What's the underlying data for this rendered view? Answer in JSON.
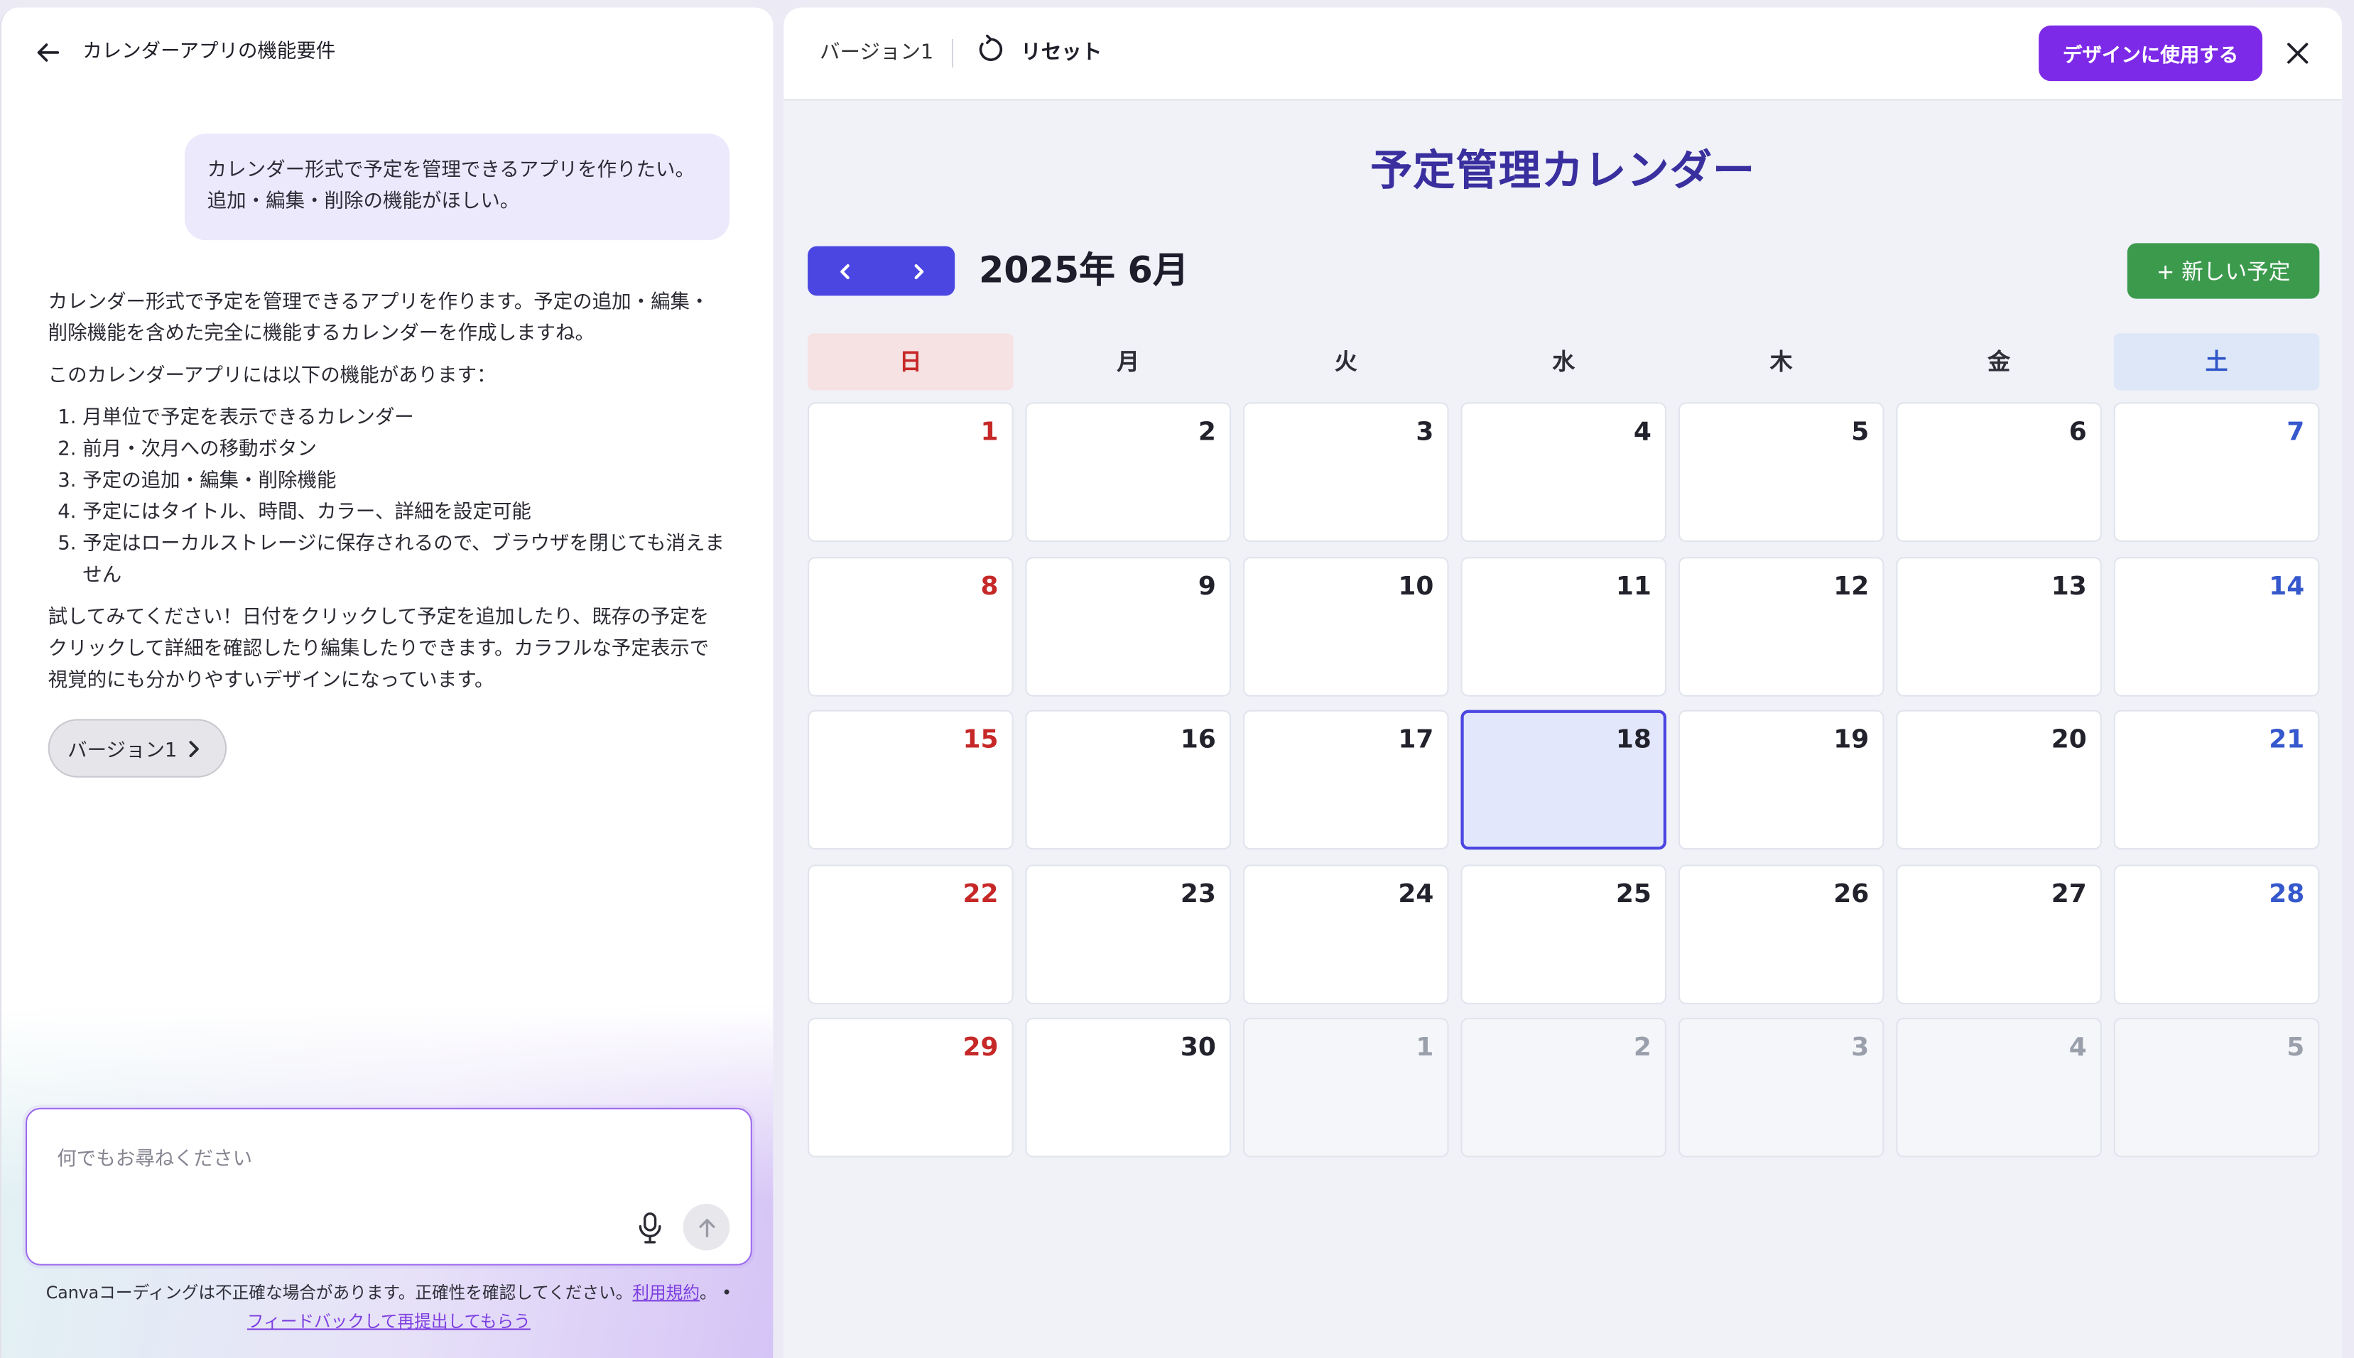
{
  "chat": {
    "header": {
      "back_icon": "arrow-left-icon",
      "title": "カレンダーアプリの機能要件"
    },
    "user_message": [
      "カレンダー形式で予定を管理できるアプリを作りたい。",
      "追加・編集・削除の機能がほしい。"
    ],
    "assistant": {
      "intro": "カレンダー形式で予定を管理できるアプリを作ります。予定の追加・編集・削除機能を含めた完全に機能するカレンダーを作成しますね。",
      "features_intro": "このカレンダーアプリには以下の機能があります：",
      "features": [
        "月単位で予定を表示できるカレンダー",
        "前月・次月への移動ボタン",
        "予定の追加・編集・削除機能",
        "予定にはタイトル、時間、カラー、詳細を設定可能",
        "予定はローカルストレージに保存されるので、ブラウザを閉じても消えません"
      ],
      "closing": "試してみてください！日付をクリックして予定を追加したり、既存の予定をクリックして詳細を確認したり編集したりできます。カラフルな予定表示で視覚的にも分かりやすいデザインになっています。"
    },
    "version_chip": {
      "label": "バージョン1",
      "icon": "chevron-right-icon"
    },
    "composer": {
      "placeholder": "何でもお尋ねください",
      "mic_icon": "microphone-icon",
      "send_icon": "arrow-up-icon"
    },
    "disclaimer": {
      "text": "Canvaコーディングは不正確な場合があります。正確性を確認してください。",
      "terms_link": "利用規約",
      "terms_suffix": "。 •",
      "feedback_link": "フィードバックして再提出してもらう"
    }
  },
  "preview": {
    "header": {
      "version_label": "バージョン1",
      "reset_icon": "refresh-icon",
      "reset_label": "リセット",
      "use_button": "デザインに使用する",
      "close_icon": "close-icon"
    },
    "calendar": {
      "title": "予定管理カレンダー",
      "prev_icon": "chevron-left-icon",
      "next_icon": "chevron-right-icon",
      "month_label": "2025年 6月",
      "new_event_button": "+ 新しい予定",
      "weekdays": [
        "日",
        "月",
        "火",
        "水",
        "木",
        "金",
        "土"
      ],
      "weeks": [
        [
          {
            "day": "1"
          },
          {
            "day": "2"
          },
          {
            "day": "3"
          },
          {
            "day": "4"
          },
          {
            "day": "5"
          },
          {
            "day": "6"
          },
          {
            "day": "7"
          }
        ],
        [
          {
            "day": "8"
          },
          {
            "day": "9"
          },
          {
            "day": "10"
          },
          {
            "day": "11"
          },
          {
            "day": "12"
          },
          {
            "day": "13"
          },
          {
            "day": "14"
          }
        ],
        [
          {
            "day": "15"
          },
          {
            "day": "16"
          },
          {
            "day": "17"
          },
          {
            "day": "18",
            "today": true
          },
          {
            "day": "19"
          },
          {
            "day": "20"
          },
          {
            "day": "21"
          }
        ],
        [
          {
            "day": "22"
          },
          {
            "day": "23"
          },
          {
            "day": "24"
          },
          {
            "day": "25"
          },
          {
            "day": "26"
          },
          {
            "day": "27"
          },
          {
            "day": "28"
          }
        ],
        [
          {
            "day": "29"
          },
          {
            "day": "30"
          },
          {
            "day": "1",
            "other_month": true
          },
          {
            "day": "2",
            "other_month": true
          },
          {
            "day": "3",
            "other_month": true
          },
          {
            "day": "4",
            "other_month": true
          },
          {
            "day": "5",
            "other_month": true
          }
        ]
      ]
    }
  },
  "colors": {
    "canva_purple": "#7d2ae8",
    "calendar_title": "#3a2f9e",
    "nav_indigo": "#4b46e1",
    "new_event_green": "#3c9a4d",
    "sunday_red": "#c62828",
    "saturday_blue": "#3558cc",
    "today_fill": "#e2e7fb",
    "user_bubble": "#ede9fc"
  }
}
